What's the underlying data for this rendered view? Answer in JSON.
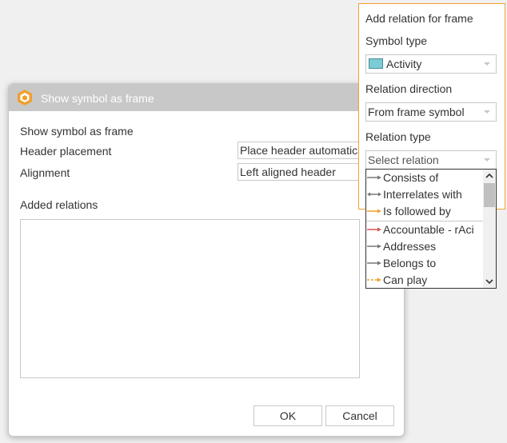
{
  "dialog": {
    "title": "Show symbol as frame",
    "show_symbol_label": "Show symbol as frame",
    "header_placement_label": "Header placement",
    "header_placement_value": "Place header automatically",
    "alignment_label": "Alignment",
    "alignment_value": "Left aligned header",
    "added_relations_label": "Added relations",
    "ok_label": "OK",
    "cancel_label": "Cancel"
  },
  "panel": {
    "title": "Add relation for frame",
    "symbol_type_label": "Symbol type",
    "symbol_type_value": "Activity",
    "relation_direction_label": "Relation direction",
    "relation_direction_value": "From frame symbol",
    "relation_type_label": "Relation type",
    "relation_type_placeholder": "Select relation"
  },
  "relation_options": [
    {
      "label": "Consists of",
      "icon": "arrow-gray-icon",
      "color": "#777777"
    },
    {
      "label": "Interrelates with",
      "icon": "double-arrow-gray-icon",
      "color": "#777777"
    },
    {
      "label": "Is followed by",
      "icon": "arrow-orange-icon",
      "color": "#f0a030"
    },
    {
      "label": "Accountable - rAci",
      "icon": "arrow-red-icon",
      "color": "#d9534f"
    },
    {
      "label": "Addresses",
      "icon": "arrow-gray-icon",
      "color": "#777777"
    },
    {
      "label": "Belongs to",
      "icon": "arrow-gray-icon",
      "color": "#777777"
    },
    {
      "label": "Can play",
      "icon": "dashed-arrow-orange-icon",
      "color": "#f0a030"
    }
  ],
  "colors": {
    "accent": "#f0a030",
    "titlebar": "#c8c8c8",
    "activity": "#7ccbd6"
  }
}
